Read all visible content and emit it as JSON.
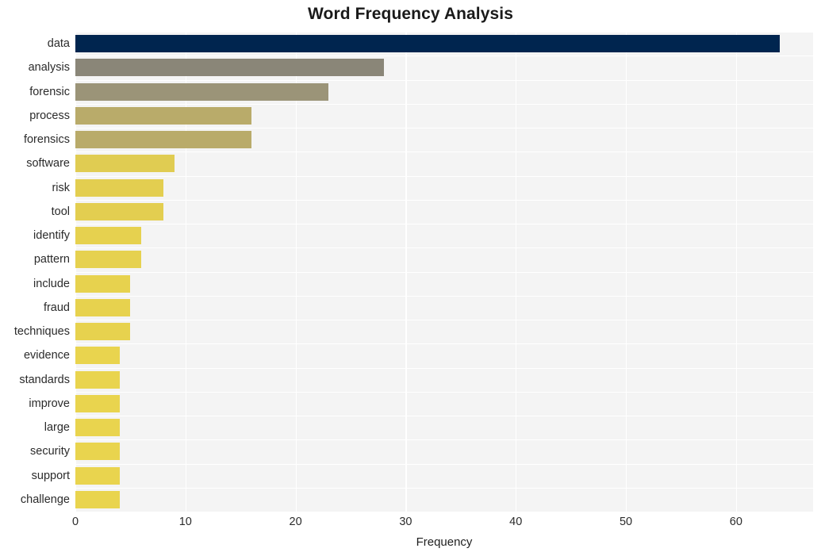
{
  "chart_data": {
    "type": "bar",
    "orientation": "horizontal",
    "title": "Word Frequency Analysis",
    "xlabel": "Frequency",
    "ylabel": "",
    "categories": [
      "data",
      "analysis",
      "forensic",
      "process",
      "forensics",
      "software",
      "risk",
      "tool",
      "identify",
      "pattern",
      "include",
      "fraud",
      "techniques",
      "evidence",
      "standards",
      "improve",
      "large",
      "security",
      "support",
      "challenge"
    ],
    "values": [
      64,
      28,
      23,
      16,
      16,
      9,
      8,
      8,
      6,
      6,
      5,
      5,
      5,
      4,
      4,
      4,
      4,
      4,
      4,
      4
    ],
    "bar_colors": [
      "#00254f",
      "#8a8678",
      "#9b9478",
      "#b9ab6a",
      "#b9ab6a",
      "#e0cc52",
      "#e3ce50",
      "#e3ce50",
      "#e6d14f",
      "#e6d14f",
      "#e7d24e",
      "#e7d24e",
      "#e7d24e",
      "#e9d44e",
      "#e9d44e",
      "#e9d44e",
      "#e9d44e",
      "#e9d44e",
      "#e9d44e",
      "#e9d44e"
    ],
    "xlim": [
      0,
      67
    ],
    "ylim_categories": 20,
    "xticks": [
      0,
      10,
      20,
      30,
      40,
      50,
      60
    ],
    "xtick_labels": [
      "0",
      "10",
      "20",
      "30",
      "40",
      "50",
      "60"
    ],
    "grid": true,
    "grid_color": "#ffffff",
    "plot_background": "#f4f4f4",
    "figure_background": "#ffffff",
    "legend": null,
    "colormap": "cividis"
  }
}
